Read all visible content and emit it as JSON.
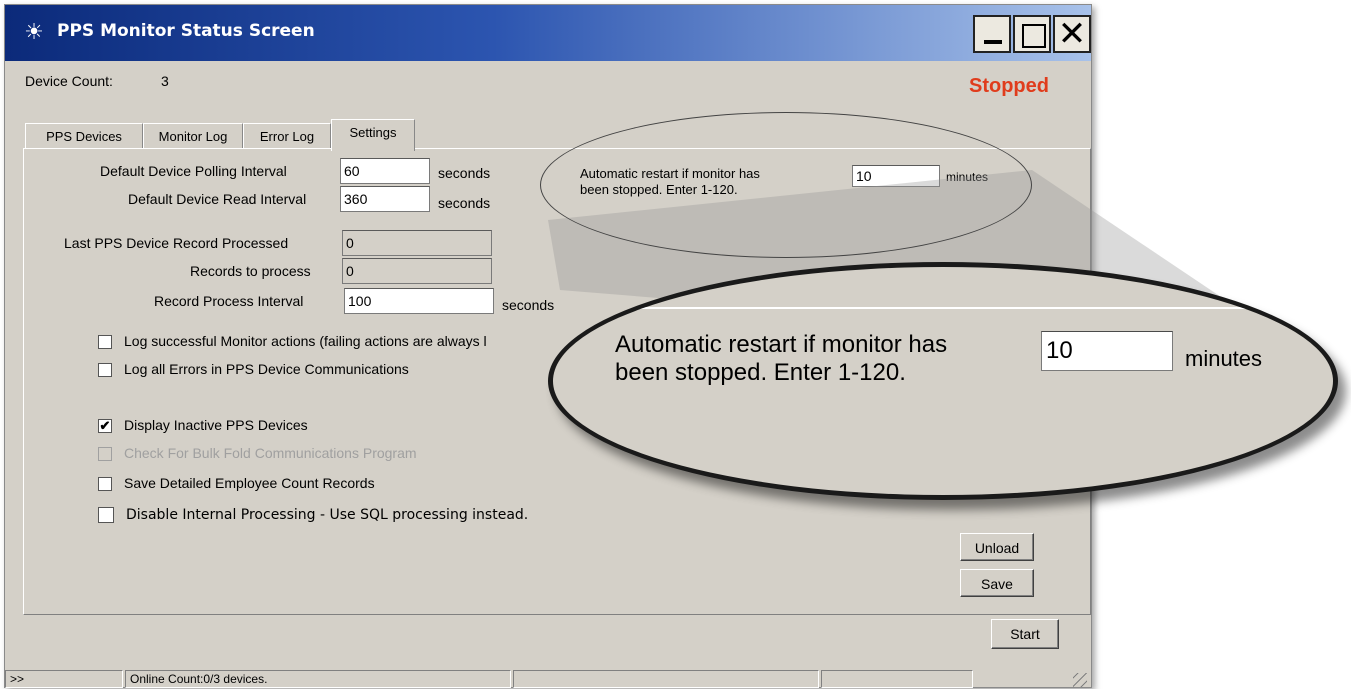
{
  "window": {
    "title": "PPS Monitor Status Screen",
    "icon": "lightbulb-icon",
    "controls": {
      "minimize": "minimize-icon",
      "maximize": "maximize-icon",
      "close": "close-icon"
    }
  },
  "header": {
    "device_count_label": "Device Count:",
    "device_count_value": "3",
    "status": "Stopped",
    "status_color": "#e03c1c"
  },
  "tabs": [
    {
      "label": "PPS Devices"
    },
    {
      "label": "Monitor Log"
    },
    {
      "label": "Error Log"
    },
    {
      "label": "Settings"
    }
  ],
  "settings": {
    "polling_label": "Default Device Polling Interval",
    "polling_value": "60",
    "polling_unit": "seconds",
    "read_label": "Default Device Read Interval",
    "read_value": "360",
    "read_unit": "seconds",
    "last_record_label": "Last PPS Device Record Processed",
    "last_record_value": "0",
    "records_to_process_label": "Records to process",
    "records_to_process_value": "0",
    "process_interval_label": "Record Process Interval",
    "process_interval_value": "100",
    "process_interval_unit": "seconds",
    "checkboxes": [
      {
        "label": "Log successful Monitor actions (failing actions are always l",
        "checked": false,
        "enabled": true
      },
      {
        "label": "Log all Errors in PPS Device Communications",
        "checked": false,
        "enabled": true
      },
      {
        "label": "Display Inactive PPS Devices",
        "checked": true,
        "enabled": true
      },
      {
        "label": "Check For Bulk Fold Communications Program",
        "checked": false,
        "enabled": false
      },
      {
        "label": "Save Detailed Employee Count Records",
        "checked": false,
        "enabled": true
      },
      {
        "label": "Disable Internal Processing - Use SQL processing instead.",
        "checked": false,
        "enabled": true
      }
    ],
    "restart_label_line1": "Automatic restart if monitor has",
    "restart_label_line2": "been stopped. Enter 1-120.",
    "restart_value": "10",
    "restart_unit": "minutes"
  },
  "buttons": {
    "unload": "Unload",
    "save": "Save",
    "start": "Start"
  },
  "statusbar": {
    "cell1": ">>",
    "cell2": "Online Count:0/3 devices.",
    "cell3": "",
    "cell4": "",
    "cell5": ""
  },
  "callout": {
    "line1": "Automatic restart if monitor has",
    "line2": "been stopped. Enter 1-120.",
    "value": "10",
    "unit": "minutes"
  }
}
